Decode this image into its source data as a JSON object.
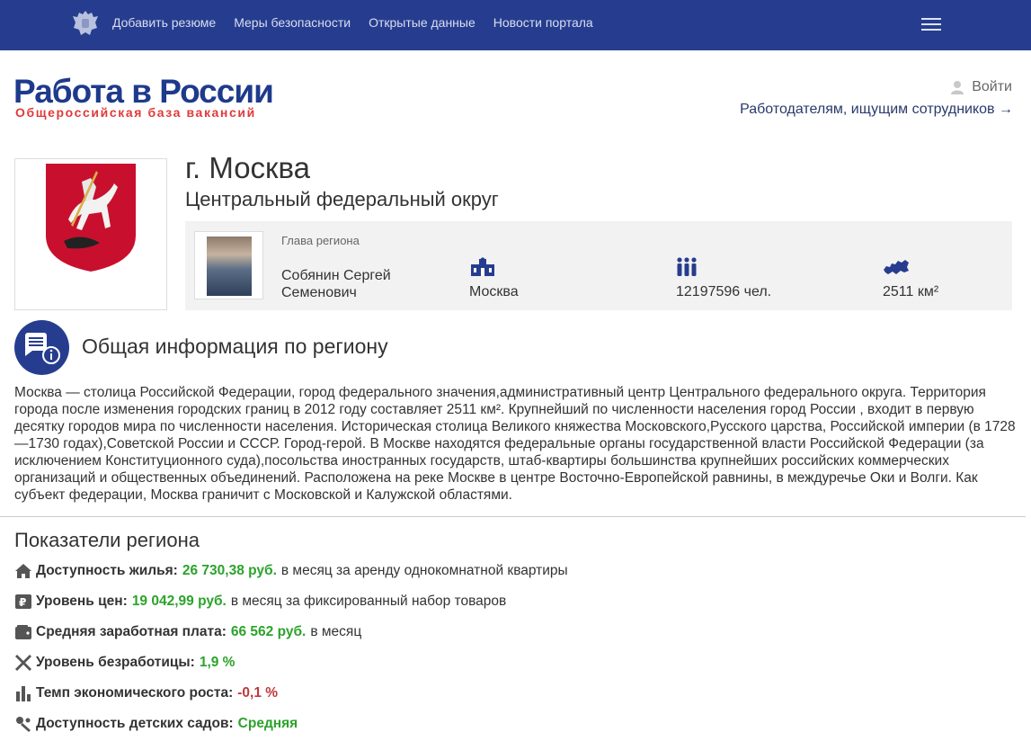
{
  "topbar": {
    "nav": [
      "Добавить резюме",
      "Меры безопасности",
      "Открытые данные",
      "Новости портала"
    ]
  },
  "logo": {
    "title": "Работа в России",
    "subtitle": "Общероссийская база вакансий"
  },
  "header": {
    "login_label": "Войти",
    "employers_link": "Работодателям, ищущим сотрудников →"
  },
  "region": {
    "title": "г. Москва",
    "district": "Центральный федеральный округ",
    "head_label": "Глава региона",
    "head_name_line1": "Собянин Сергей",
    "head_name_line2": "Семенович",
    "capital": "Москва",
    "population": "12197596 чел.",
    "area": "2511 км²"
  },
  "general": {
    "title": "Общая информация по региону",
    "description": "Москва — столица Российской Федерации, город федерального значения,административный центр Центрального федерального округа. Территория города после изменения городских границ в 2012 году составляет 2511 км². Крупнейший по численности населения город России , входит в первую десятку городов мира по численности населения. Историческая столица Великого княжества Московского,Русского царства, Российской империи (в 1728—1730 годах),Советской России и СССР. Город-герой. В Москве находятся федеральные органы государственной власти Российской Федерации (за исключением Конституционного суда),посольства иностранных государств, штаб-квартиры большинства крупнейших российских коммерческих организаций и общественных объединений. Расположена на реке Москве в центре Восточно-Европейской равнины, в междуречье Оки и Волги. Как субъект федерации, Москва граничит с Московской и Калужской областями."
  },
  "indicators": {
    "title": "Показатели региона",
    "items": [
      {
        "icon": "house-icon",
        "label": "Доступность жилья:",
        "value": "26 730,38 руб.",
        "rest": "в месяц за аренду однокомнатной квартиры",
        "color": "#2ba32b"
      },
      {
        "icon": "price-tag-icon",
        "label": "Уровень цен:",
        "value": "19 042,99 руб.",
        "rest": "в месяц за фиксированный набор товаров",
        "color": "#2ba32b"
      },
      {
        "icon": "wallet-icon",
        "label": "Средняя заработная плата:",
        "value": "66 562 руб.",
        "rest": "в месяц",
        "color": "#2ba32b"
      },
      {
        "icon": "tools-icon",
        "label": "Уровень безработицы:",
        "value": "1,9 %",
        "rest": "",
        "color": "#2ba32b"
      },
      {
        "icon": "bar-chart-icon",
        "label": "Темп экономического роста:",
        "value": "-0,1 %",
        "rest": "",
        "color": "#c0393b"
      },
      {
        "icon": "kindergarten-icon",
        "label": "Доступность детских садов:",
        "value": "Средняя",
        "rest": "",
        "color": "#2ba32b"
      }
    ]
  },
  "colors": {
    "brand": "#263d8f",
    "good": "#2ba32b",
    "bad": "#c0393b"
  }
}
